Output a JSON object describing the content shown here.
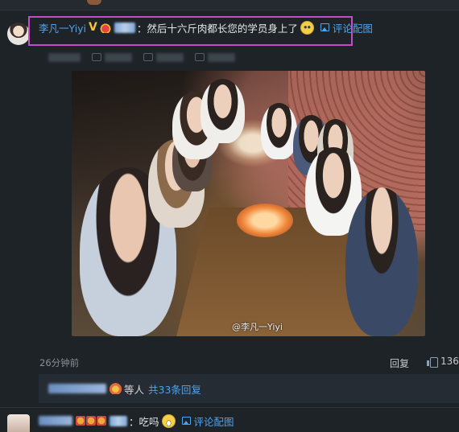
{
  "main_comment": {
    "username": "李凡一Yiyi",
    "v_badge": "V",
    "text": "：然后十六斤肉都长您的学员身上了",
    "view_image_label": "评论配图"
  },
  "photo": {
    "watermark": "@李凡一Yiyi"
  },
  "meta": {
    "time": "26分钟前",
    "reply_label": "回复",
    "like_count": "136"
  },
  "replies_summary": {
    "middle_text": "等人",
    "link_text": "共33条回复"
  },
  "next_comment": {
    "text": "：吃吗",
    "view_image_label": "评论配图"
  },
  "colors": {
    "background": "#1e2328",
    "link": "#4ea3f0",
    "highlight_border": "#c64ac9"
  }
}
